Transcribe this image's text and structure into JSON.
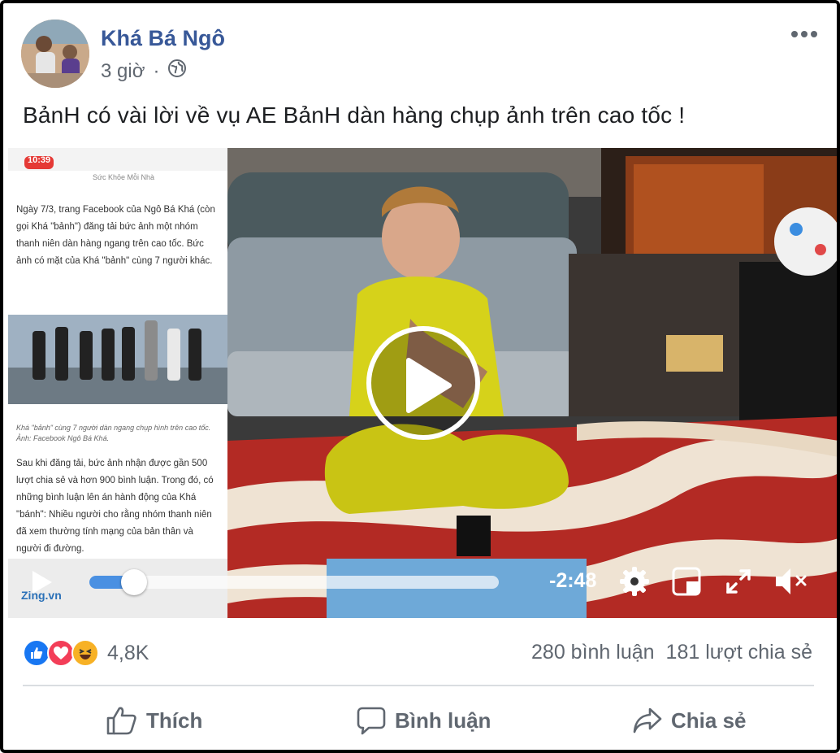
{
  "post": {
    "author": "Khá Bá Ngô",
    "time": "3 giờ",
    "caption": "BảnH có vài lời về vụ AE BảnH dàn hàng chụp ảnh trên cao tốc !"
  },
  "video": {
    "time_remaining": "-2:48",
    "progress": 0.07,
    "inset_article": {
      "status_time": "10:39",
      "top_label": "Sức Khỏe Mỗi Nhà",
      "paragraph_1": "Ngày 7/3, trang Facebook của Ngô Bá Khá (còn gọi Khá \"bảnh\") đăng tải bức ảnh một nhóm thanh niên dàn hàng ngang trên cao tốc. Bức ảnh có mặt của Khá \"bảnh\" cùng 7 người khác.",
      "photo_caption": "Khá \"bảnh\" cùng 7 người dàn ngang chụp hình trên cao tốc. Ảnh: Facebook Ngô Bá Khá.",
      "paragraph_2": "Sau khi đăng tải, bức ảnh nhận được gần 500 lượt chia sẻ và hơn 900 bình luận. Trong đó, có những bình luận lên án hành động của Khá \"bánh\": Nhiều người cho rằng nhóm thanh niên đã xem thường tính mạng của bản thân và người đi đường.",
      "source_logo": "Zing.vn"
    }
  },
  "stats": {
    "reactions_count": "4,8K",
    "comments": "280 bình luận",
    "shares": "181 lượt chia sẻ"
  },
  "actions": {
    "like": "Thích",
    "comment": "Bình luận",
    "share": "Chia sẻ"
  },
  "colors": {
    "brand_blue": "#385898",
    "like_blue": "#1877f2",
    "love_red": "#f33e58",
    "haha_yellow": "#f7b125",
    "progress_blue": "#4a90e2"
  }
}
